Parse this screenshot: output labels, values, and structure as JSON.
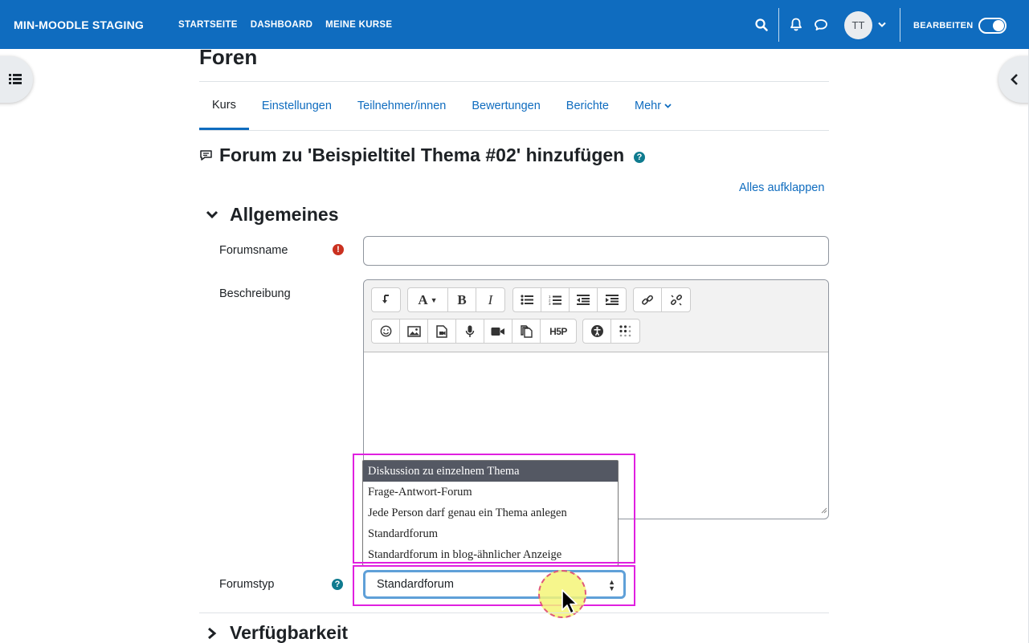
{
  "navbar": {
    "brand": "MIN-MOODLE STAGING",
    "links": [
      "STARTSEITE",
      "DASHBOARD",
      "MEINE KURSE"
    ],
    "user_initials": "TT",
    "edit_label": "BEARBEITEN",
    "edit_mode_on": true,
    "icons": [
      "search-icon",
      "bell-icon",
      "chat-icon",
      "chevron-down-icon"
    ]
  },
  "page": {
    "heading": "Foren",
    "tabs": [
      "Kurs",
      "Einstellungen",
      "Teilnehmer/innen",
      "Bewertungen",
      "Berichte",
      "Mehr"
    ],
    "active_tab": "Kurs",
    "form_title": "Forum zu 'Beispieltitel Thema #02' hinzufügen",
    "expand_all": "Alles aufklappen"
  },
  "sections": {
    "general": "Allgemeines",
    "availability": "Verfügbarkeit"
  },
  "fields": {
    "name_label": "Forumsname",
    "name_value": "",
    "description_label": "Beschreibung",
    "type_label": "Forumstyp",
    "type_value": "Standardforum"
  },
  "dropdown": {
    "options": [
      "Diskussion zu einzelnem Thema",
      "Frage-Antwort-Forum",
      "Jede Person darf genau ein Thema anlegen",
      "Standardforum",
      "Standardforum in blog-ähnlicher Anzeige"
    ],
    "highlighted_index": 0
  },
  "colors": {
    "brand": "#0f6cbf",
    "highlight_box": "#e020e0",
    "required": "#ca3120",
    "help": "#0f7b8f"
  }
}
